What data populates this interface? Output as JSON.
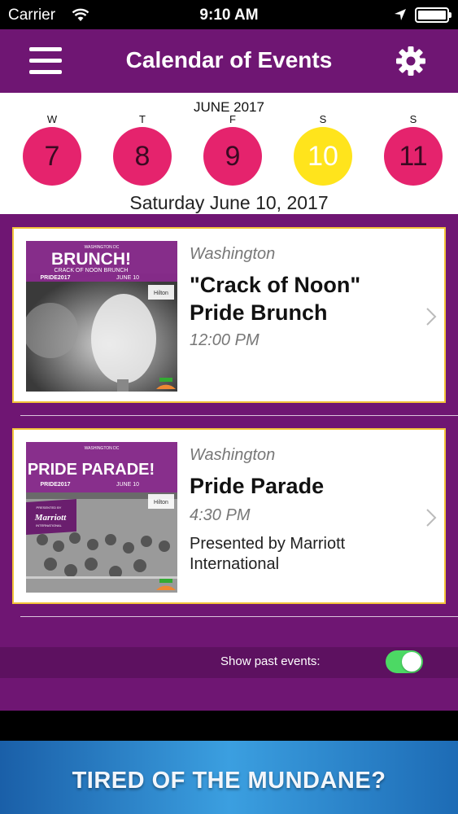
{
  "status_bar": {
    "carrier": "Carrier",
    "time": "9:10 AM"
  },
  "navbar": {
    "title": "Calendar of Events",
    "menu_icon": "hamburger-menu-icon",
    "settings_icon": "gear-icon"
  },
  "calendar": {
    "month": "JUNE 2017",
    "days": [
      {
        "dow": "W",
        "date": "7",
        "selected": false
      },
      {
        "dow": "T",
        "date": "8",
        "selected": false
      },
      {
        "dow": "F",
        "date": "9",
        "selected": false
      },
      {
        "dow": "S",
        "date": "10",
        "selected": true
      },
      {
        "dow": "S",
        "date": "11",
        "selected": false
      }
    ],
    "selected_label": "Saturday June 10, 2017"
  },
  "events": [
    {
      "city": "Washington",
      "name": "\"Crack of Noon\" Pride Brunch",
      "time": "12:00 PM",
      "presenter": "",
      "thumb": {
        "top_text": "WASHINGTON DC",
        "headline": "BRUNCH!",
        "sub": "CRACK OF NOON BRUNCH",
        "pride": "PRIDE2017",
        "date": "JUNE 10",
        "sponsor": "Hilton"
      }
    },
    {
      "city": "Washington",
      "name": "Pride Parade",
      "time": "4:30 PM",
      "presenter": "Presented by Marriott International",
      "thumb": {
        "top_text": "WASHINGTON DC",
        "headline": "PRIDE PARADE!",
        "pride": "PRIDE2017",
        "date": "JUNE 10",
        "sponsor": "Hilton",
        "presented_by": "PRESENTED BY",
        "brand": "Marriott",
        "brand_sub": "INTERNATIONAL"
      }
    }
  ],
  "past_events": {
    "label": "Show past events:",
    "enabled": true
  },
  "ad": {
    "headline": "TIRED OF THE MUNDANE?"
  },
  "colors": {
    "primary": "#6f1673",
    "day_circle": "#e5236d",
    "selected_day": "#ffe41c",
    "card_border": "#f2c43a",
    "toggle_on": "#4cd964"
  }
}
